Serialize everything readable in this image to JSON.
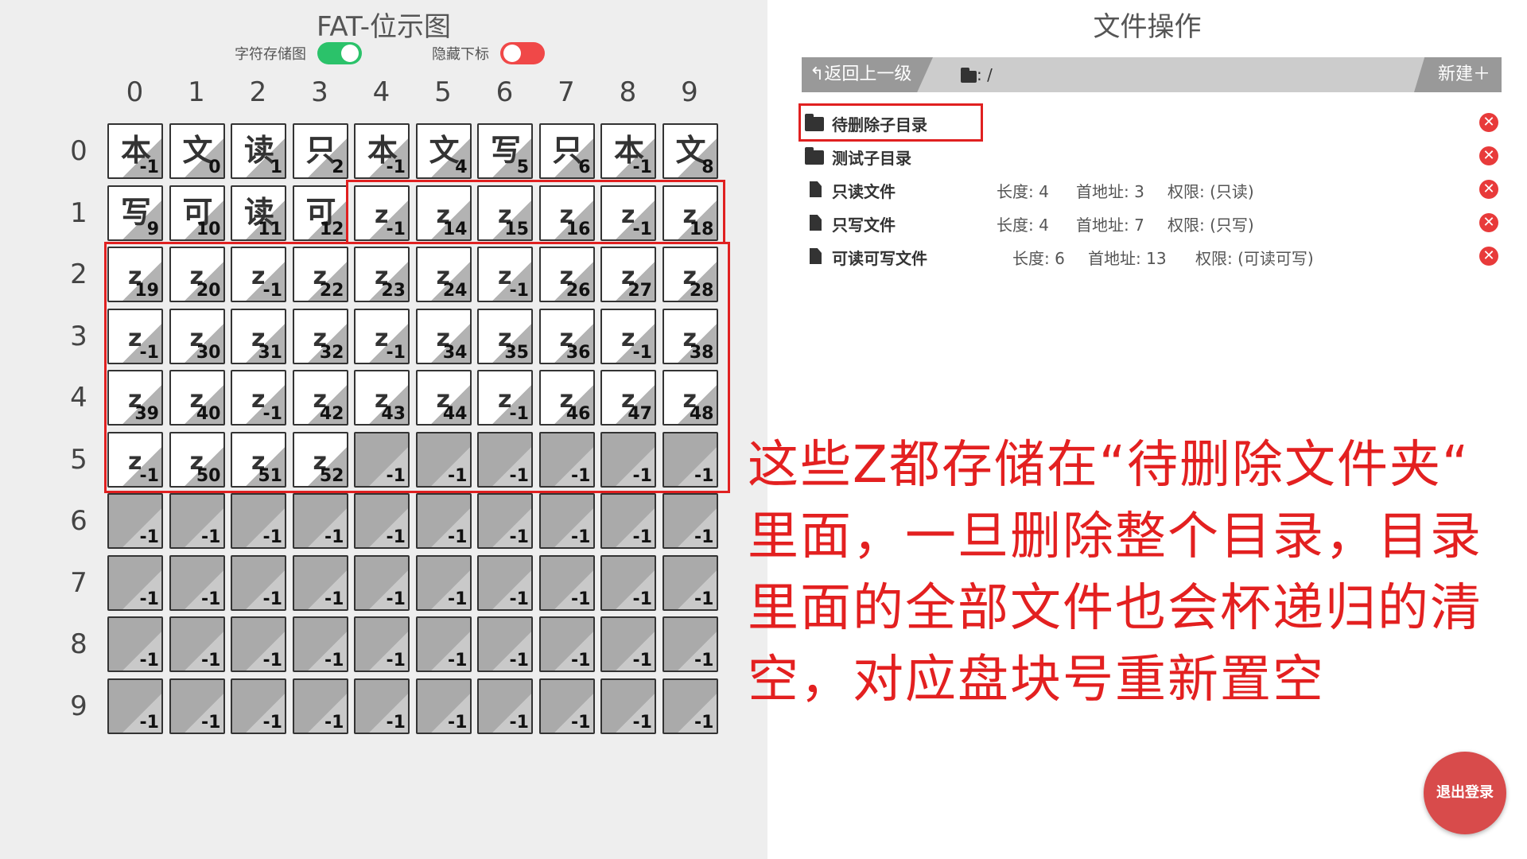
{
  "left": {
    "title": "FAT-位示图",
    "toggles": [
      {
        "label": "字符存储图",
        "state": "on"
      },
      {
        "label": "隐藏下标",
        "state": "off"
      }
    ],
    "columns": [
      "0",
      "1",
      "2",
      "3",
      "4",
      "5",
      "6",
      "7",
      "8",
      "9"
    ],
    "rows": [
      "0",
      "1",
      "2",
      "3",
      "4",
      "5",
      "6",
      "7",
      "8",
      "9"
    ],
    "grid": [
      [
        {
          "c": "本",
          "i": "-1"
        },
        {
          "c": "文",
          "i": "0"
        },
        {
          "c": "读",
          "i": "1"
        },
        {
          "c": "只",
          "i": "2"
        },
        {
          "c": "本",
          "i": "-1"
        },
        {
          "c": "文",
          "i": "4"
        },
        {
          "c": "写",
          "i": "5"
        },
        {
          "c": "只",
          "i": "6"
        },
        {
          "c": "本",
          "i": "-1"
        },
        {
          "c": "文",
          "i": "8"
        }
      ],
      [
        {
          "c": "写",
          "i": "9"
        },
        {
          "c": "可",
          "i": "10"
        },
        {
          "c": "读",
          "i": "11"
        },
        {
          "c": "可",
          "i": "12"
        },
        {
          "c": "z",
          "i": "-1"
        },
        {
          "c": "z",
          "i": "14"
        },
        {
          "c": "z",
          "i": "15"
        },
        {
          "c": "z",
          "i": "16"
        },
        {
          "c": "z",
          "i": "-1"
        },
        {
          "c": "z",
          "i": "18"
        }
      ],
      [
        {
          "c": "z",
          "i": "19"
        },
        {
          "c": "z",
          "i": "20"
        },
        {
          "c": "z",
          "i": "-1"
        },
        {
          "c": "z",
          "i": "22"
        },
        {
          "c": "z",
          "i": "23"
        },
        {
          "c": "z",
          "i": "24"
        },
        {
          "c": "z",
          "i": "-1"
        },
        {
          "c": "z",
          "i": "26"
        },
        {
          "c": "z",
          "i": "27"
        },
        {
          "c": "z",
          "i": "28"
        }
      ],
      [
        {
          "c": "z",
          "i": "-1"
        },
        {
          "c": "z",
          "i": "30"
        },
        {
          "c": "z",
          "i": "31"
        },
        {
          "c": "z",
          "i": "32"
        },
        {
          "c": "z",
          "i": "-1"
        },
        {
          "c": "z",
          "i": "34"
        },
        {
          "c": "z",
          "i": "35"
        },
        {
          "c": "z",
          "i": "36"
        },
        {
          "c": "z",
          "i": "-1"
        },
        {
          "c": "z",
          "i": "38"
        }
      ],
      [
        {
          "c": "z",
          "i": "39"
        },
        {
          "c": "z",
          "i": "40"
        },
        {
          "c": "z",
          "i": "-1"
        },
        {
          "c": "z",
          "i": "42"
        },
        {
          "c": "z",
          "i": "43"
        },
        {
          "c": "z",
          "i": "44"
        },
        {
          "c": "z",
          "i": "-1"
        },
        {
          "c": "z",
          "i": "46"
        },
        {
          "c": "z",
          "i": "47"
        },
        {
          "c": "z",
          "i": "48"
        }
      ],
      [
        {
          "c": "z",
          "i": "-1"
        },
        {
          "c": "z",
          "i": "50"
        },
        {
          "c": "z",
          "i": "51"
        },
        {
          "c": "z",
          "i": "52"
        },
        {
          "c": "",
          "i": "-1"
        },
        {
          "c": "",
          "i": "-1"
        },
        {
          "c": "",
          "i": "-1"
        },
        {
          "c": "",
          "i": "-1"
        },
        {
          "c": "",
          "i": "-1"
        },
        {
          "c": "",
          "i": "-1"
        }
      ],
      [
        {
          "c": "",
          "i": "-1"
        },
        {
          "c": "",
          "i": "-1"
        },
        {
          "c": "",
          "i": "-1"
        },
        {
          "c": "",
          "i": "-1"
        },
        {
          "c": "",
          "i": "-1"
        },
        {
          "c": "",
          "i": "-1"
        },
        {
          "c": "",
          "i": "-1"
        },
        {
          "c": "",
          "i": "-1"
        },
        {
          "c": "",
          "i": "-1"
        },
        {
          "c": "",
          "i": "-1"
        }
      ],
      [
        {
          "c": "",
          "i": "-1"
        },
        {
          "c": "",
          "i": "-1"
        },
        {
          "c": "",
          "i": "-1"
        },
        {
          "c": "",
          "i": "-1"
        },
        {
          "c": "",
          "i": "-1"
        },
        {
          "c": "",
          "i": "-1"
        },
        {
          "c": "",
          "i": "-1"
        },
        {
          "c": "",
          "i": "-1"
        },
        {
          "c": "",
          "i": "-1"
        },
        {
          "c": "",
          "i": "-1"
        }
      ],
      [
        {
          "c": "",
          "i": "-1"
        },
        {
          "c": "",
          "i": "-1"
        },
        {
          "c": "",
          "i": "-1"
        },
        {
          "c": "",
          "i": "-1"
        },
        {
          "c": "",
          "i": "-1"
        },
        {
          "c": "",
          "i": "-1"
        },
        {
          "c": "",
          "i": "-1"
        },
        {
          "c": "",
          "i": "-1"
        },
        {
          "c": "",
          "i": "-1"
        },
        {
          "c": "",
          "i": "-1"
        }
      ],
      [
        {
          "c": "",
          "i": "-1"
        },
        {
          "c": "",
          "i": "-1"
        },
        {
          "c": "",
          "i": "-1"
        },
        {
          "c": "",
          "i": "-1"
        },
        {
          "c": "",
          "i": "-1"
        },
        {
          "c": "",
          "i": "-1"
        },
        {
          "c": "",
          "i": "-1"
        },
        {
          "c": "",
          "i": "-1"
        },
        {
          "c": "",
          "i": "-1"
        },
        {
          "c": "",
          "i": "-1"
        }
      ]
    ]
  },
  "right": {
    "title": "文件操作",
    "back_label": "↰返回上一级",
    "path": ": /",
    "new_label": "新建＋",
    "entries": [
      {
        "type": "folder",
        "name": "待删除子目录",
        "length": "",
        "address": "",
        "permission": "",
        "highlight": true
      },
      {
        "type": "folder",
        "name": "测试子目录",
        "length": "",
        "address": "",
        "permission": "",
        "highlight": false
      },
      {
        "type": "file",
        "name": "只读文件",
        "length": "长度: 4",
        "address": "首地址: 3",
        "permission": "权限: (只读)",
        "highlight": false
      },
      {
        "type": "file",
        "name": "只写文件",
        "length": "长度: 4",
        "address": "首地址: 7",
        "permission": "权限: (只写)",
        "highlight": false
      },
      {
        "type": "file",
        "name": "可读可写文件",
        "length": "长度: 6",
        "address": "首地址: 13",
        "permission": "权限: (可读可写)",
        "highlight": false
      }
    ],
    "delete_glyph": "✕",
    "logout_label": "退出登录"
  },
  "annotation": "这些Z都存储在“待删除文件夹“\n里面，一旦删除整个目录，目录\n里面的全部文件也会杯递归的清\n空，对应盘块号重新置空",
  "colors": {
    "annotation_red": "#e32020",
    "toggle_on": "#2bc26a",
    "toggle_off": "#f04848",
    "logout": "#d84b4b"
  }
}
